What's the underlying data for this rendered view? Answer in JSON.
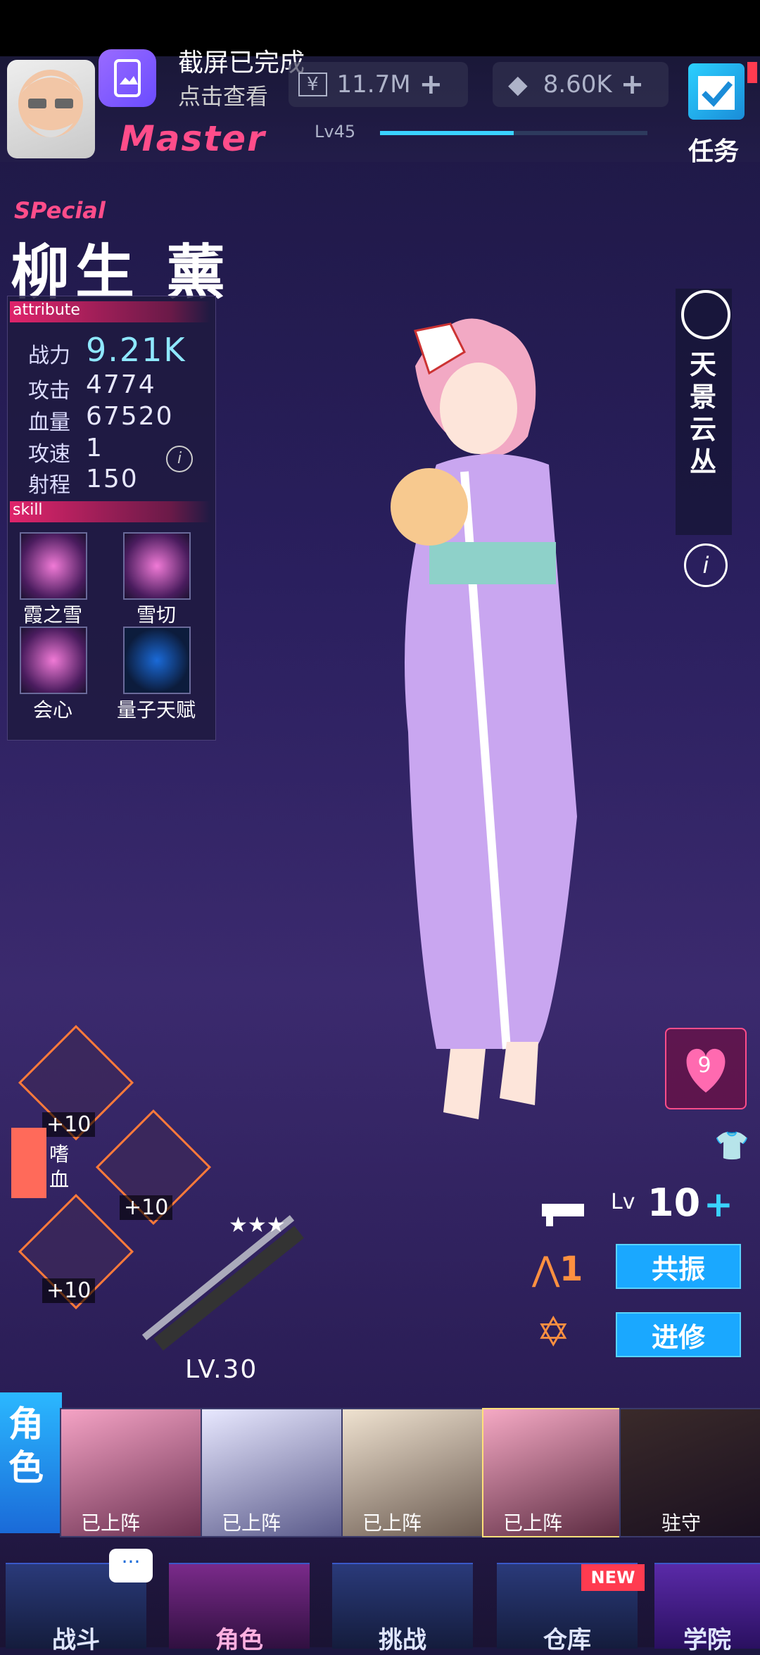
{
  "notification": {
    "title": "截屏已完成",
    "subtitle": "点击查看"
  },
  "resources": [
    {
      "icon": "yen-icon",
      "value": "11.7M"
    },
    {
      "icon": "crystal-icon",
      "value": "8.60K"
    }
  ],
  "player": {
    "rank": "Master",
    "level": "Lv45"
  },
  "task": {
    "label": "任务"
  },
  "character": {
    "tag": "SPecial",
    "name": "柳生 薰",
    "attribute_header": "attribute",
    "stats": [
      {
        "label": "战力",
        "value": "9.21K"
      },
      {
        "label": "攻击",
        "value": "4774"
      },
      {
        "label": "血量",
        "value": "67520"
      },
      {
        "label": "攻速",
        "value": "1"
      },
      {
        "label": "射程",
        "value": "150"
      }
    ],
    "skill_header": "skill",
    "skills": [
      {
        "label": "霞之雪"
      },
      {
        "label": "雪切"
      },
      {
        "label": "会心"
      },
      {
        "label": "量子天赋"
      }
    ],
    "side_tag": "天景云丛",
    "favor": "9"
  },
  "weapon": {
    "level": "10",
    "level_prefix": "Lv",
    "equip_bonus": "+10",
    "weapon_lv": "LV.30",
    "rank": "1",
    "buff": "嗜血"
  },
  "buttons": {
    "resonance": "共振",
    "advance": "进修"
  },
  "roster": {
    "tab": "角色",
    "members": [
      {
        "status": "已上阵"
      },
      {
        "status": "已上阵"
      },
      {
        "status": "已上阵"
      },
      {
        "status": "已上阵"
      },
      {
        "status": "驻守"
      }
    ]
  },
  "nav": [
    {
      "label": "战斗"
    },
    {
      "label": "角色"
    },
    {
      "label": "挑战"
    },
    {
      "label": "仓库"
    },
    {
      "label": "学院"
    }
  ],
  "badges": {
    "new": "NEW"
  },
  "colors": {
    "accent": "#ff4d8a",
    "blue": "#1aa8ff"
  }
}
